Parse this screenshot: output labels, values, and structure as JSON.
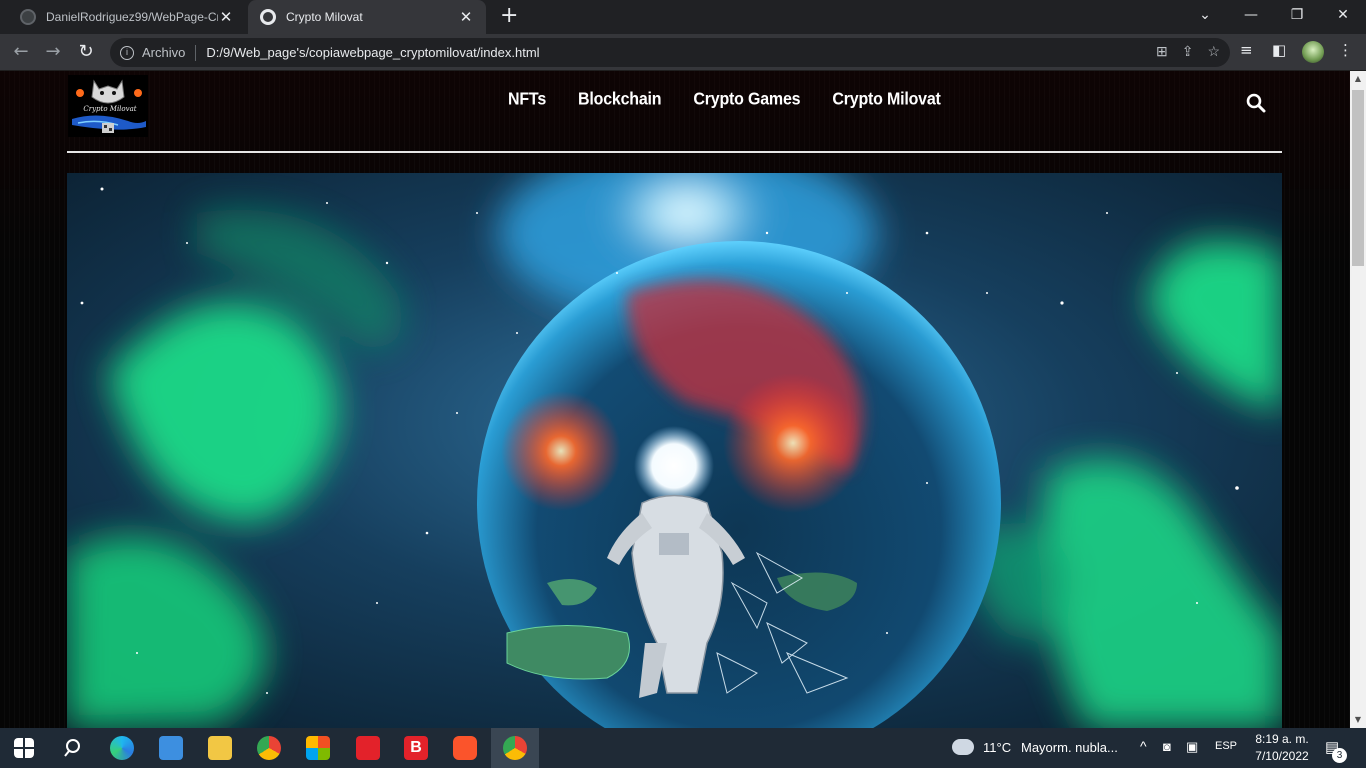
{
  "browser": {
    "tabs": [
      {
        "title": "DanielRodriguez99/WebPage-Cr",
        "active": false
      },
      {
        "title": "Crypto Milovat",
        "active": true
      }
    ],
    "new_tab_glyph": "+",
    "window_controls": [
      "chevron-down",
      "minimize",
      "restore",
      "close"
    ],
    "address": {
      "scheme_label": "Archivo",
      "url": "D:/9/Web_page's/copiawebpage_cryptomilovat/index.html"
    }
  },
  "site": {
    "logo_text": "Crypto Milovat",
    "nav": [
      "NFTs",
      "Blockchain",
      "Crypto Games",
      "Crypto Milovat"
    ]
  },
  "taskbar": {
    "weather_temp": "11°C",
    "weather_text": "Mayorm. nubla...",
    "language": "ESP",
    "time": "8:19 a. m.",
    "date": "7/10/2022",
    "notification_count": "3"
  },
  "colors": {
    "accent": "#8ab4f8",
    "aurora_green": "#1ee28a",
    "nebula_blue": "#3fa8e8",
    "planet_red": "#ff4a2a"
  }
}
